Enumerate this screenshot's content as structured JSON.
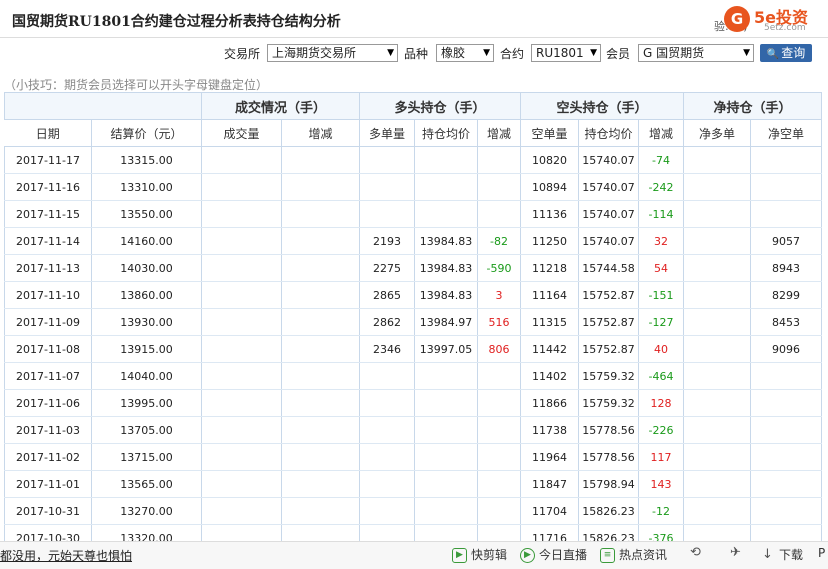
{
  "title": "国贸期货RU1801合约建仓过程分析表持仓结构分析",
  "logo": {
    "glyph": "G",
    "main": "5e投资",
    "sub": "5etz.com",
    "masked": "验: 手)"
  },
  "filters": {
    "exchange_label": "交易所",
    "exchange_value": "上海期货交易所",
    "variety_label": "品种",
    "variety_value": "橡胶",
    "contract_label": "合约",
    "contract_value": "RU1801",
    "member_label": "会员",
    "member_value": "G 国贸期货",
    "query_label": "查询"
  },
  "tip": "（小技巧：期货会员选择可以开头字母键盘定位）",
  "table": {
    "groups": [
      "成交情况（手）",
      "多头持仓（手）",
      "空头持仓（手）",
      "净持仓（手）"
    ],
    "columns": [
      "日期",
      "结算价（元）",
      "成交量",
      "增减",
      "多单量",
      "持仓均价",
      "增减",
      "空单量",
      "持仓均价",
      "增减",
      "净多单",
      "净空单"
    ],
    "rows": [
      [
        "2017-11-17",
        "13315.00",
        "",
        "",
        "",
        "",
        "",
        "10820",
        "15740.07",
        "-74",
        "",
        ""
      ],
      [
        "2017-11-16",
        "13310.00",
        "",
        "",
        "",
        "",
        "",
        "10894",
        "15740.07",
        "-242",
        "",
        ""
      ],
      [
        "2017-11-15",
        "13550.00",
        "",
        "",
        "",
        "",
        "",
        "11136",
        "15740.07",
        "-114",
        "",
        ""
      ],
      [
        "2017-11-14",
        "14160.00",
        "",
        "",
        "2193",
        "13984.83",
        "-82",
        "11250",
        "15740.07",
        "32",
        "",
        "9057"
      ],
      [
        "2017-11-13",
        "14030.00",
        "",
        "",
        "2275",
        "13984.83",
        "-590",
        "11218",
        "15744.58",
        "54",
        "",
        "8943"
      ],
      [
        "2017-11-10",
        "13860.00",
        "",
        "",
        "2865",
        "13984.83",
        "3",
        "11164",
        "15752.87",
        "-151",
        "",
        "8299"
      ],
      [
        "2017-11-09",
        "13930.00",
        "",
        "",
        "2862",
        "13984.97",
        "516",
        "11315",
        "15752.87",
        "-127",
        "",
        "8453"
      ],
      [
        "2017-11-08",
        "13915.00",
        "",
        "",
        "2346",
        "13997.05",
        "806",
        "11442",
        "15752.87",
        "40",
        "",
        "9096"
      ],
      [
        "2017-11-07",
        "14040.00",
        "",
        "",
        "",
        "",
        "",
        "11402",
        "15759.32",
        "-464",
        "",
        ""
      ],
      [
        "2017-11-06",
        "13995.00",
        "",
        "",
        "",
        "",
        "",
        "11866",
        "15759.32",
        "128",
        "",
        ""
      ],
      [
        "2017-11-03",
        "13705.00",
        "",
        "",
        "",
        "",
        "",
        "11738",
        "15778.56",
        "-226",
        "",
        ""
      ],
      [
        "2017-11-02",
        "13715.00",
        "",
        "",
        "",
        "",
        "",
        "11964",
        "15778.56",
        "117",
        "",
        ""
      ],
      [
        "2017-11-01",
        "13565.00",
        "",
        "",
        "",
        "",
        "",
        "11847",
        "15798.94",
        "143",
        "",
        ""
      ],
      [
        "2017-10-31",
        "13270.00",
        "",
        "",
        "",
        "",
        "",
        "11704",
        "15826.23",
        "-12",
        "",
        ""
      ],
      [
        "2017-10-30",
        "13320.00",
        "",
        "",
        "",
        "",
        "",
        "11716",
        "15826.23",
        "-376",
        "",
        ""
      ]
    ],
    "colors": {
      "up": "#e02020",
      "down": "#1a9a1a"
    }
  },
  "bottom": {
    "news": "都没用，元始天尊也惧怕",
    "tools": [
      {
        "label": "快剪辑",
        "icon": "play-icon"
      },
      {
        "label": "今日直播",
        "icon": "live-icon"
      },
      {
        "label": "热点资讯",
        "icon": "news-icon"
      },
      {
        "label": "",
        "icon": "refresh-icon"
      },
      {
        "label": "",
        "icon": "pin-icon"
      },
      {
        "label": "下载",
        "icon": "download-icon"
      },
      {
        "label": "P",
        "icon": ""
      }
    ]
  }
}
